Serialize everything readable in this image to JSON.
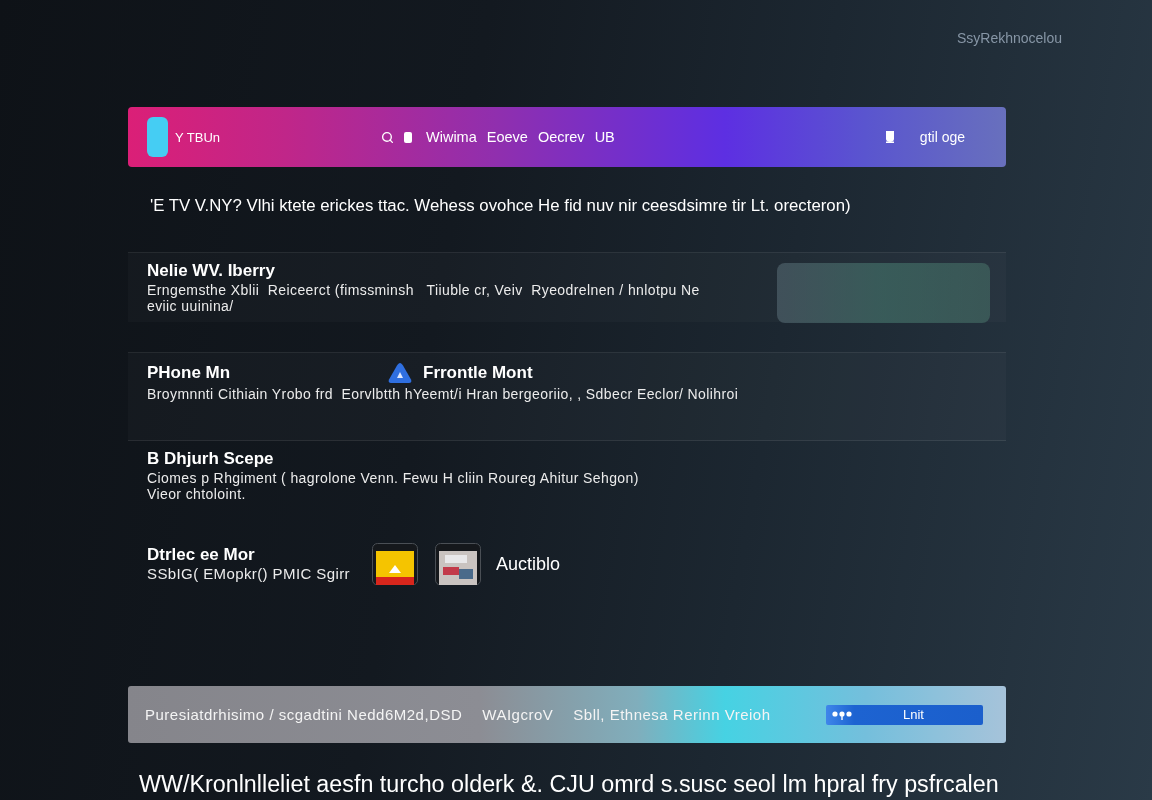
{
  "top_caption": "SsyRekhnocelou",
  "header": {
    "logo_text": "Y TBUn",
    "nav": [
      "Wiwima",
      "Eoeve",
      "Oecrev",
      "UB"
    ],
    "account_label": "gtil oge"
  },
  "headline": "'E TV V.NY? Vlhi ktete erickes ttac. Wehess ovohce He fid nuv nir ceesdsimre tir Lt. orecteron)",
  "rows": [
    {
      "kind": "thumbnail",
      "title": "Nelie WV. Iberry",
      "description_lines": [
        "Erngemsthe Xblii  Reiceerct (fimssminsh   Tiiuble cr, Veiv  Ryeodrelnen / hnlotpu Ne",
        "eviic uuinina/"
      ]
    },
    {
      "kind": "app",
      "title": "PHone Mn",
      "app_label": "Frrontle Mont",
      "description_lines": [
        "Broymnnti Cithiain Yrobo frd  Eorvlbtth hYeemt/i Hran bergeoriio, , Sdbecr Eeclor/ Nolihroi"
      ]
    },
    {
      "kind": "plain",
      "title": "B Dhjurh Scepe",
      "description_lines": [
        "Ciomes p Rhgiment ( hagrolone Venn. Fewu H cliin Roureg Ahitur Sehgon)",
        "Vieor chtoloint."
      ]
    },
    {
      "kind": "tiles",
      "title": "Dtrlec ee Mor",
      "app_label": "Auctiblo",
      "description_lines": [
        "SSbIG( EMopkr() PMIC Sgirr"
      ]
    }
  ],
  "bottom_bar": {
    "items": [
      "Puresiatdrhisimo / scgadtini  Nedd6M2d,DSD",
      "WAIgcroV",
      "Sbll, Ethnesa Rerinn Vreioh"
    ],
    "button": "Lnit"
  },
  "footer": "WW/Kronlnlleliet aesfn turcho olderk &. CJU omrd s.susc seol lm hpral fry psfrcalen"
}
